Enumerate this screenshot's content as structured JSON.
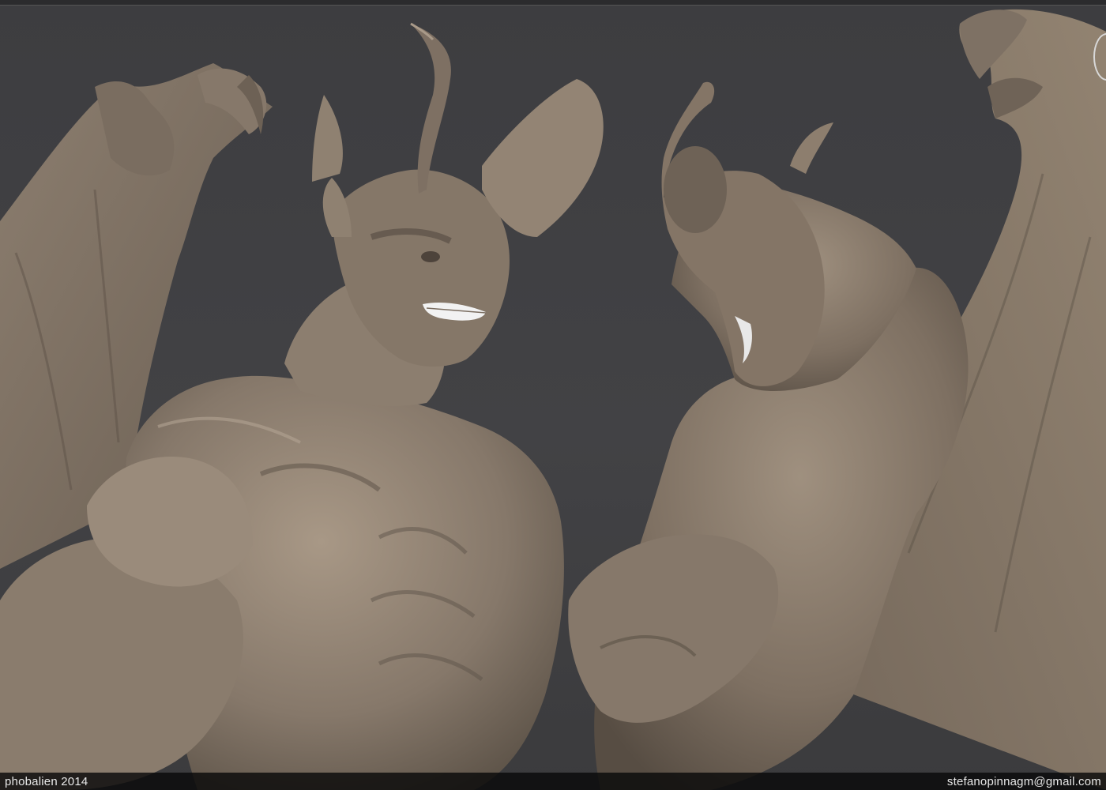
{
  "image": {
    "subject": "two winged demons facing each other",
    "colors": {
      "background": "#3f3f42",
      "clay": "#8a7b6c",
      "clay_shadow": "#5c5146",
      "clay_highlight": "#b2a393",
      "teeth": "#f2f2f2"
    }
  },
  "footer": {
    "left_credit": "phobalien 2014",
    "right_credit": "stefanopinnagm@gmail.com"
  }
}
